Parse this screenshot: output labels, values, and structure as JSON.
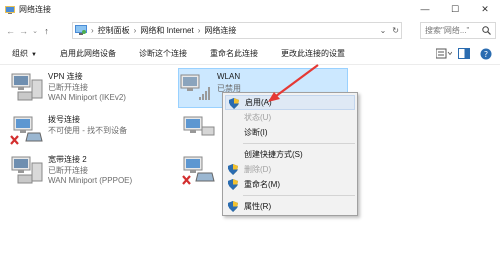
{
  "window": {
    "title": "网络连接",
    "controls": {
      "minimize": "—",
      "maximize": "☐",
      "close": "✕"
    }
  },
  "nav": {
    "back": "←",
    "forward": "→",
    "recent": "⌄",
    "up": "↑",
    "breadcrumbs": [
      "控制面板",
      "网络和 Internet",
      "网络连接"
    ],
    "separator": "›",
    "dropdown": "⌄",
    "refresh": "↻",
    "search_placeholder": "搜索\"网络...\""
  },
  "toolbar": {
    "organize": "组织",
    "organize_caret": "▼",
    "items": [
      "启用此网络设备",
      "诊断这个连接",
      "重命名此连接",
      "更改此连接的设置"
    ],
    "right_icons": [
      "view-options-icon",
      "preview-pane-icon",
      "help-icon"
    ]
  },
  "connections": [
    {
      "name": "VPN 连接",
      "status": "已断开连接",
      "device": "WAN Miniport (IKEv2)",
      "icon": "vpn-computer-icon"
    },
    {
      "name": "拨号连接",
      "status": "不可使用 - 找不到设备",
      "device": "",
      "icon": "dialup-modem-icon"
    },
    {
      "name": "宽带连接 2",
      "status": "已断开连接",
      "device": "WAN Miniport (PPPOE)",
      "icon": "broadband-computer-icon"
    },
    {
      "name": "WLAN",
      "status": "已禁用",
      "device": "",
      "icon": "wlan-signal-icon"
    },
    {
      "name": "",
      "status": "",
      "device": "",
      "icon": "ethernet-computer-icon"
    },
    {
      "name": "",
      "status": "",
      "device": "",
      "icon": "ethernet-computer-icon"
    }
  ],
  "context_menu": {
    "items": [
      {
        "label": "启用(A)",
        "shield": true,
        "disabled": false,
        "hover": true
      },
      {
        "label": "状态(U)",
        "shield": false,
        "disabled": true
      },
      {
        "label": "诊断(I)",
        "shield": false,
        "disabled": false
      },
      {
        "label": "创建快捷方式(S)",
        "shield": false,
        "disabled": false
      },
      {
        "label": "删除(D)",
        "shield": true,
        "disabled": true
      },
      {
        "label": "重命名(M)",
        "shield": true,
        "disabled": false
      },
      {
        "label": "属性(R)",
        "shield": true,
        "disabled": false
      }
    ]
  },
  "colors": {
    "selection_bg": "#cce8ff",
    "menu_bg": "#f2f2f2",
    "hover_bg": "#dfe9f5",
    "arrow": "#e53935",
    "disabled_x": "#d32f2f"
  }
}
